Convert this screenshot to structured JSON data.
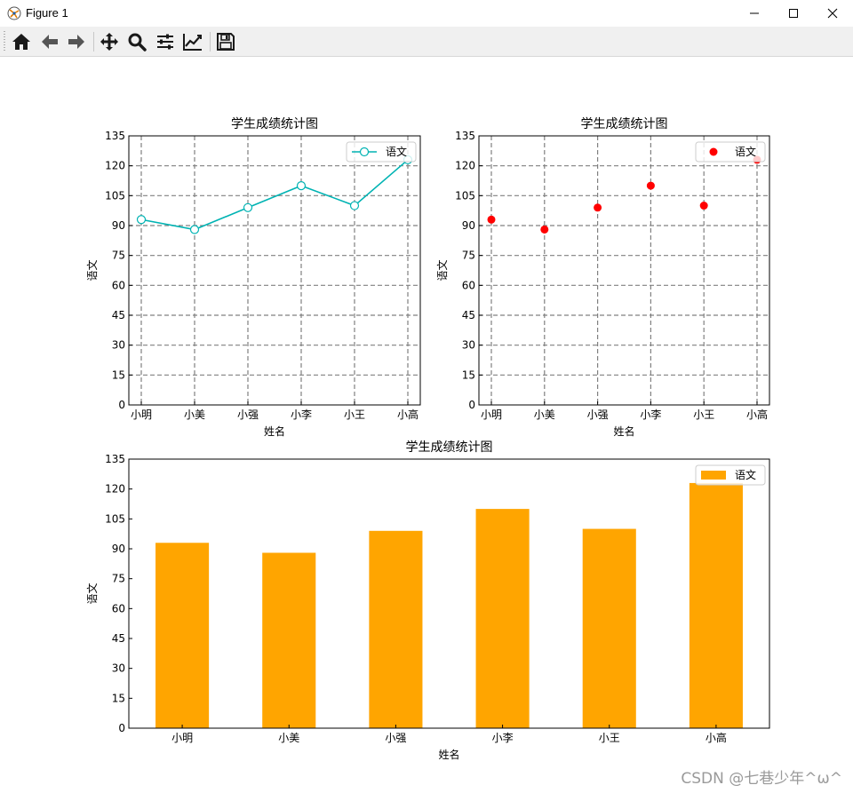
{
  "window": {
    "title": "Figure 1"
  },
  "toolbar": {
    "buttons": [
      "home-icon",
      "back-icon",
      "forward-icon",
      "pan-icon",
      "zoom-icon",
      "configure-subplots-icon",
      "edit-axis-icon",
      "save-icon"
    ]
  },
  "watermark": "CSDN @七巷少年^ω^",
  "colors": {
    "line": "#00b3b3",
    "scatter": "#ff0000",
    "bar": "#ffa500",
    "grid": "#808080"
  },
  "chart_data": [
    {
      "type": "line",
      "title": "学生成绩统计图",
      "xlabel": "姓名",
      "ylabel": "语文",
      "categories": [
        "小明",
        "小美",
        "小强",
        "小李",
        "小王",
        "小高"
      ],
      "series": [
        {
          "name": "语文",
          "values": [
            93,
            88,
            99,
            110,
            100,
            123
          ]
        }
      ],
      "yticks": [
        0,
        15,
        30,
        45,
        60,
        75,
        90,
        105,
        120,
        135
      ],
      "ylim": [
        0,
        135
      ],
      "grid": true,
      "legend": "upper right"
    },
    {
      "type": "scatter",
      "title": "学生成绩统计图",
      "xlabel": "姓名",
      "ylabel": "语文",
      "categories": [
        "小明",
        "小美",
        "小强",
        "小李",
        "小王",
        "小高"
      ],
      "series": [
        {
          "name": "语文",
          "values": [
            93,
            88,
            99,
            110,
            100,
            123
          ]
        }
      ],
      "yticks": [
        0,
        15,
        30,
        45,
        60,
        75,
        90,
        105,
        120,
        135
      ],
      "ylim": [
        0,
        135
      ],
      "grid": true,
      "legend": "upper right"
    },
    {
      "type": "bar",
      "title": "学生成绩统计图",
      "xlabel": "姓名",
      "ylabel": "语文",
      "categories": [
        "小明",
        "小美",
        "小强",
        "小李",
        "小王",
        "小高"
      ],
      "series": [
        {
          "name": "语文",
          "values": [
            93,
            88,
            99,
            110,
            100,
            123
          ]
        }
      ],
      "yticks": [
        0,
        15,
        30,
        45,
        60,
        75,
        90,
        105,
        120,
        135
      ],
      "ylim": [
        0,
        135
      ],
      "grid": false,
      "legend": "upper right"
    }
  ]
}
